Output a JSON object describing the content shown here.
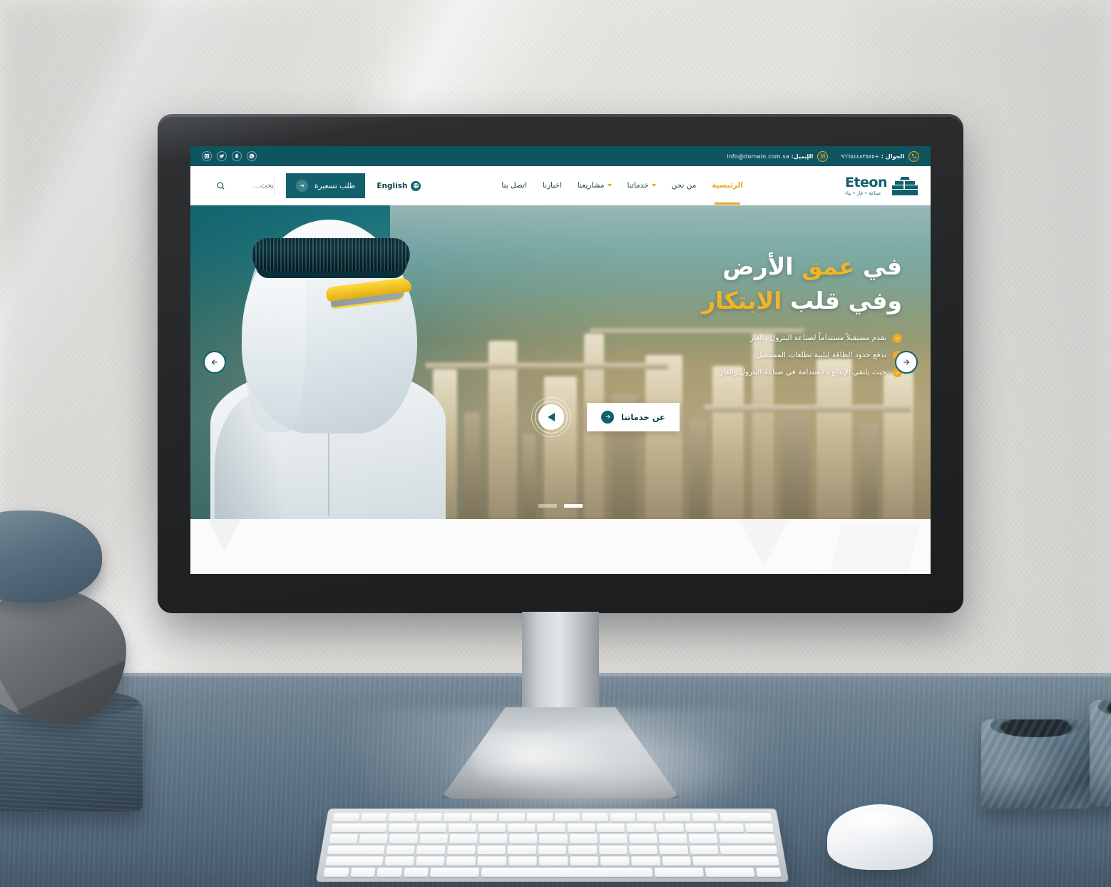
{
  "topbar": {
    "phone_label": "الجوال :",
    "phone_value": "+٩٦٦٥٤٤٨٣٥٨٥",
    "email_label": "الإيميل:",
    "email_value": "info@domain.com.sa",
    "socials": [
      "instagram-icon",
      "twitter-icon",
      "snapchat-icon",
      "whatsapp-icon"
    ],
    "accent_color": "#e3a72f",
    "bg_color": "#0e5560"
  },
  "nav": {
    "brand_name": "Eteon",
    "brand_sub": "صناعة • غاز • بناء",
    "menu": [
      {
        "label": "الرئيسية",
        "active": true,
        "has_caret": false
      },
      {
        "label": "من نحن",
        "active": false,
        "has_caret": false
      },
      {
        "label": "خدماتنا",
        "active": false,
        "has_caret": true
      },
      {
        "label": "مشاريعنا",
        "active": false,
        "has_caret": true
      },
      {
        "label": "اخبارنا",
        "active": false,
        "has_caret": false
      },
      {
        "label": "اتصل بنا",
        "active": false,
        "has_caret": false
      }
    ],
    "language_label": "English",
    "quote_label": "طلب تسعيرة",
    "search_placeholder": "بحث...",
    "active_color": "#e9a61f",
    "brand_color": "#12606d"
  },
  "hero": {
    "heading_line1_a": "في ",
    "heading_line1_gold": "عمق",
    "heading_line1_b": " الأرض",
    "heading_line2_a": "وفي قلب ",
    "heading_line2_gold": "الابتكار",
    "bullets": [
      "نقدم مستقبلاً مستداماً لصناعة البترول والغاز",
      "ندفع حدود الطاقة لتلبية تطلعات المستقبل",
      "حيث يلتقي الإبداع بالاستدامة في صناعة البترول والغاز"
    ],
    "services_button": "عن خدماتنا",
    "play_button": "play-icon",
    "prev_arrow": "arrow-left-icon",
    "next_arrow": "arrow-right-icon",
    "slides_total": 2,
    "slide_active": 2,
    "gold_color": "#f0b429"
  }
}
